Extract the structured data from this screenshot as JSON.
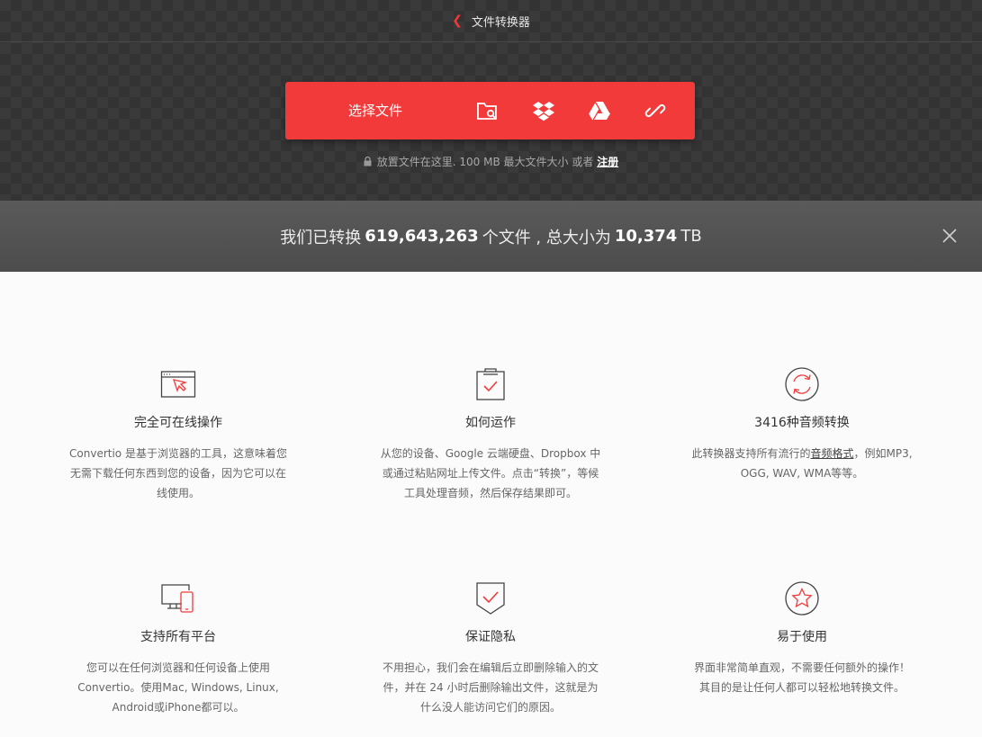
{
  "header": {
    "back_icon": "chevron-left-icon",
    "title": "文件转换器"
  },
  "upload": {
    "choose_label": "选择文件",
    "sources": [
      "folder-search-icon",
      "dropbox-icon",
      "google-drive-icon",
      "link-icon"
    ],
    "note_prefix": "放置文件在这里. 100 MB 最大文件大小 或者",
    "register_link": "注册"
  },
  "stats": {
    "prefix": "我们已转换",
    "files_count": "619,643,263",
    "middle": "个文件 , 总大小为",
    "total_size": "10,374",
    "unit": "TB"
  },
  "features": [
    {
      "icon": "browser-cursor-icon",
      "title": "完全可在线操作",
      "desc": "Convertio 是基于浏览器的工具，这意味着您无需下载任何东西到您的设备，因为它可以在线使用。"
    },
    {
      "icon": "clipboard-check-icon",
      "title": "如何运作",
      "desc": "从您的设备、Google 云端硬盘、Dropbox 中或通过粘贴网址上传文件。点击“转换”，等候工具处理音频，然后保存结果即可。"
    },
    {
      "icon": "refresh-icon",
      "title": "3416种音频转换",
      "desc_prefix": "此转换器支持所有流行的",
      "desc_link": "音频格式",
      "desc_suffix": "，例如MP3, OGG, WAV, WMA等等。"
    },
    {
      "icon": "devices-icon",
      "title": "支持所有平台",
      "desc": "您可以在任何浏览器和任何设备上使用Convertio。使用Mac, Windows, Linux, Android或iPhone都可以。"
    },
    {
      "icon": "shield-check-icon",
      "title": "保证隐私",
      "desc": "不用担心，我们会在编辑后立即删除输入的文件，并在 24 小时后删除输出文件，这就是为什么没人能访问它们的原因。"
    },
    {
      "icon": "star-icon",
      "title": "易于使用",
      "desc": "界面非常简单直观，不需要任何额外的操作！其目的是让任何人都可以轻松地转换文件。"
    }
  ],
  "colors": {
    "accent": "#f33a3a",
    "dark_bg": "#3a3a3a",
    "stats_bg": "#555555"
  }
}
